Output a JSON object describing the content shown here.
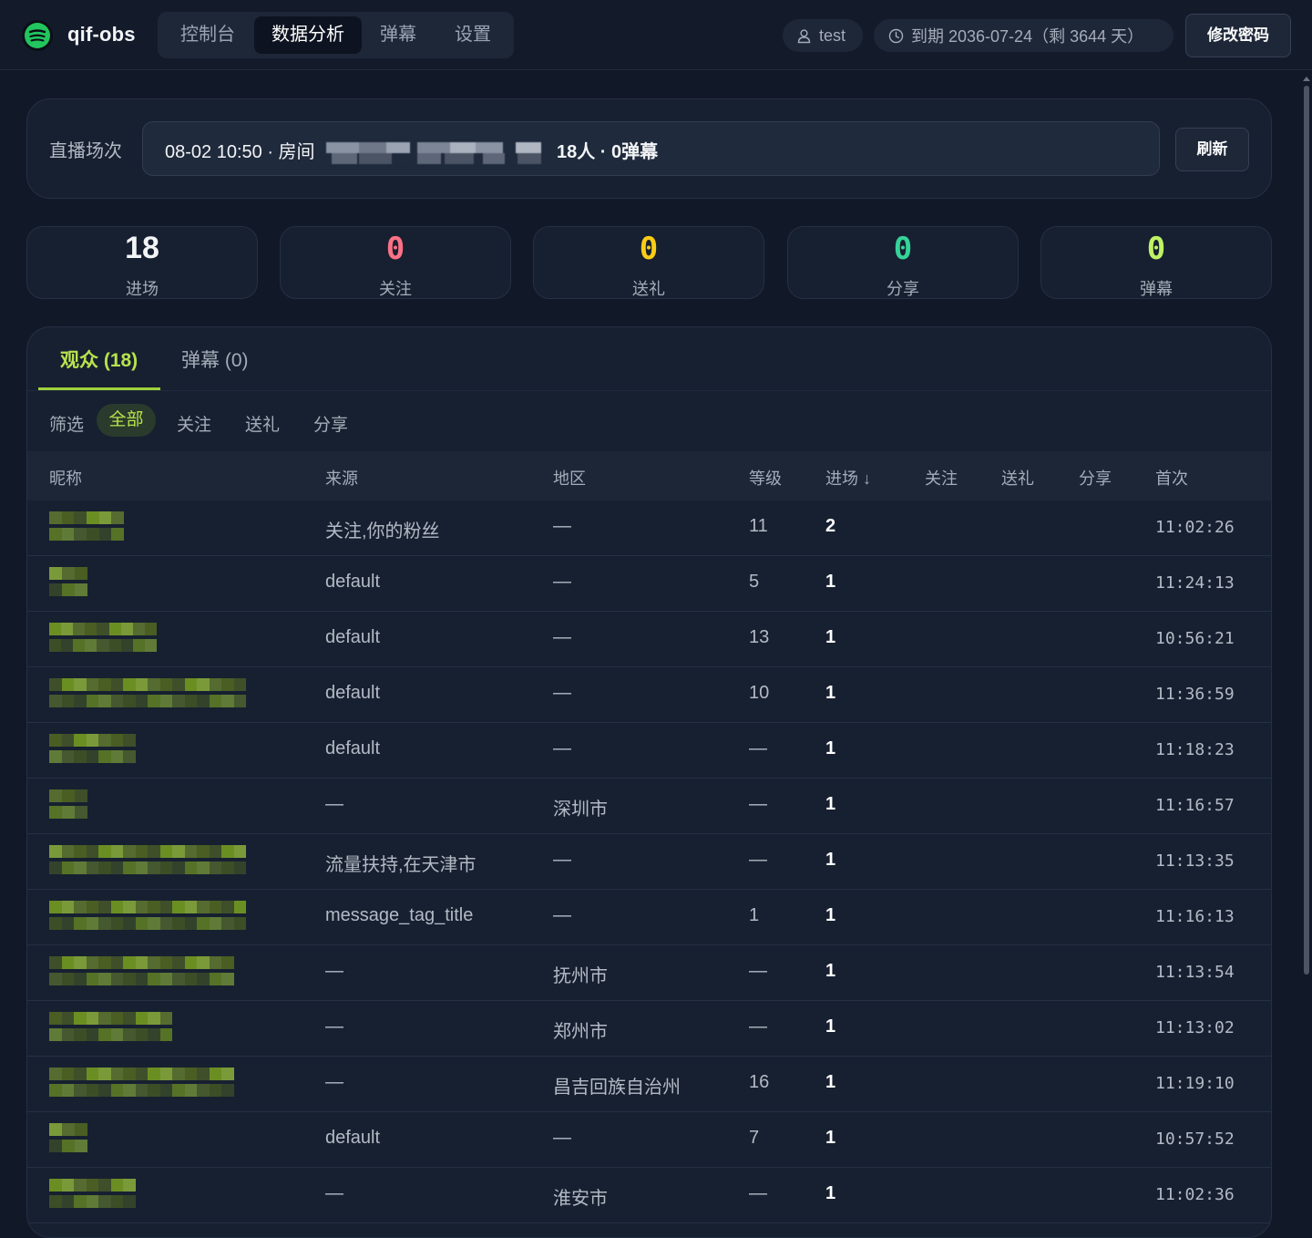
{
  "app": {
    "title": "qif-obs",
    "nav": [
      "控制台",
      "数据分析",
      "弹幕",
      "设置"
    ],
    "active_nav": "数据分析",
    "user": "test",
    "expiry": "到期 2036-07-24（剩 3644 天）",
    "change_password": "修改密码"
  },
  "session": {
    "label": "直播场次",
    "value_start": "08-02 10:50 · 房间",
    "value_end": "18人 · 0弹幕",
    "refresh": "刷新"
  },
  "stats": [
    {
      "value": "18",
      "label": "进场",
      "color": "#f3f4f6"
    },
    {
      "value": "0",
      "label": "关注",
      "color": "#fb7185"
    },
    {
      "value": "0",
      "label": "送礼",
      "color": "#facc15"
    },
    {
      "value": "0",
      "label": "分享",
      "color": "#34d399"
    },
    {
      "value": "0",
      "label": "弹幕",
      "color": "#bef264"
    }
  ],
  "tabs": {
    "audience": "观众 (18)",
    "danmaku": "弹幕 (0)"
  },
  "filters": {
    "label": "筛选",
    "items": [
      "全部",
      "关注",
      "送礼",
      "分享"
    ],
    "active": "全部"
  },
  "table": {
    "columns": [
      "昵称",
      "来源",
      "地区",
      "等级",
      "进场 ↓",
      "关注",
      "送礼",
      "分享",
      "首次"
    ],
    "rows": [
      {
        "source": "关注,你的粉丝",
        "region": "—",
        "level": "11",
        "visits": "2",
        "follow": "",
        "gift": "",
        "share": "",
        "first": "11:02:26"
      },
      {
        "source": "default",
        "region": "—",
        "level": "5",
        "visits": "1",
        "follow": "",
        "gift": "",
        "share": "",
        "first": "11:24:13"
      },
      {
        "source": "default",
        "region": "—",
        "level": "13",
        "visits": "1",
        "follow": "",
        "gift": "",
        "share": "",
        "first": "10:56:21"
      },
      {
        "source": "default",
        "region": "—",
        "level": "10",
        "visits": "1",
        "follow": "",
        "gift": "",
        "share": "",
        "first": "11:36:59"
      },
      {
        "source": "default",
        "region": "—",
        "level": "—",
        "visits": "1",
        "follow": "",
        "gift": "",
        "share": "",
        "first": "11:18:23"
      },
      {
        "source": "—",
        "region": "深圳市",
        "level": "—",
        "visits": "1",
        "follow": "",
        "gift": "",
        "share": "",
        "first": "11:16:57"
      },
      {
        "source": "流量扶持,在天津市",
        "region": "—",
        "level": "—",
        "visits": "1",
        "follow": "",
        "gift": "",
        "share": "",
        "first": "11:13:35"
      },
      {
        "source": "message_tag_title",
        "region": "—",
        "level": "1",
        "visits": "1",
        "follow": "",
        "gift": "",
        "share": "",
        "first": "11:16:13"
      },
      {
        "source": "—",
        "region": "抚州市",
        "level": "—",
        "visits": "1",
        "follow": "",
        "gift": "",
        "share": "",
        "first": "11:13:54"
      },
      {
        "source": "—",
        "region": "郑州市",
        "level": "—",
        "visits": "1",
        "follow": "",
        "gift": "",
        "share": "",
        "first": "11:13:02"
      },
      {
        "source": "—",
        "region": "昌吉回族自治州",
        "level": "16",
        "visits": "1",
        "follow": "",
        "gift": "",
        "share": "",
        "first": "11:19:10"
      },
      {
        "source": "default",
        "region": "—",
        "level": "7",
        "visits": "1",
        "follow": "",
        "gift": "",
        "share": "",
        "first": "10:57:52"
      },
      {
        "source": "—",
        "region": "淮安市",
        "level": "—",
        "visits": "1",
        "follow": "",
        "gift": "",
        "share": "",
        "first": "11:02:36"
      }
    ]
  },
  "colors": {
    "accent": "#b7e34d",
    "background": "#111827",
    "card": "#172030",
    "pixelated_nickname": [
      "#556b2f",
      "#6b8e23",
      "#4a5d23",
      "#7a9a3a",
      "#3e4f2a"
    ]
  }
}
